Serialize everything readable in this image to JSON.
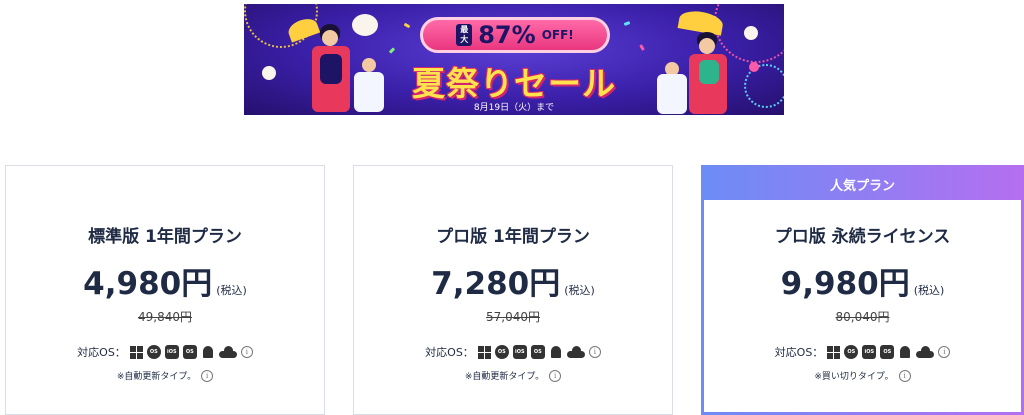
{
  "banner": {
    "max_label_top": "最",
    "max_label_bottom": "大",
    "discount": "87%",
    "off": "OFF!",
    "title": "夏祭りセール",
    "date": "8月19日（火）まで"
  },
  "cards": [
    {
      "plan": "標準版 1年間プラン",
      "price": "4,980円",
      "tax": "(税込)",
      "old_price": "49,840円",
      "os_label": "対応OS：",
      "note": "※自動更新タイプ。"
    },
    {
      "plan": "プロ版 1年間プラン",
      "price": "7,280円",
      "tax": "(税込)",
      "old_price": "57,040円",
      "os_label": "対応OS：",
      "note": "※自動更新タイプ。"
    },
    {
      "badge": "人気プラン",
      "plan": "プロ版 永続ライセンス",
      "price": "9,980円",
      "tax": "(税込)",
      "old_price": "80,040円",
      "os_label": "対応OS：",
      "note": "※買い切りタイプ。"
    }
  ],
  "os_icons": [
    "windows-icon",
    "macos-icon",
    "ios-icon",
    "ipados-icon",
    "android-icon",
    "cloud-icon",
    "info-icon"
  ],
  "colors": {
    "banner_bg": "#3a1fa8",
    "pill": "#e9367f",
    "title": "#ffe34d",
    "popular_gradient_start": "#6d8cf5",
    "popular_gradient_end": "#b46ff0",
    "text": "#1f2a44"
  }
}
